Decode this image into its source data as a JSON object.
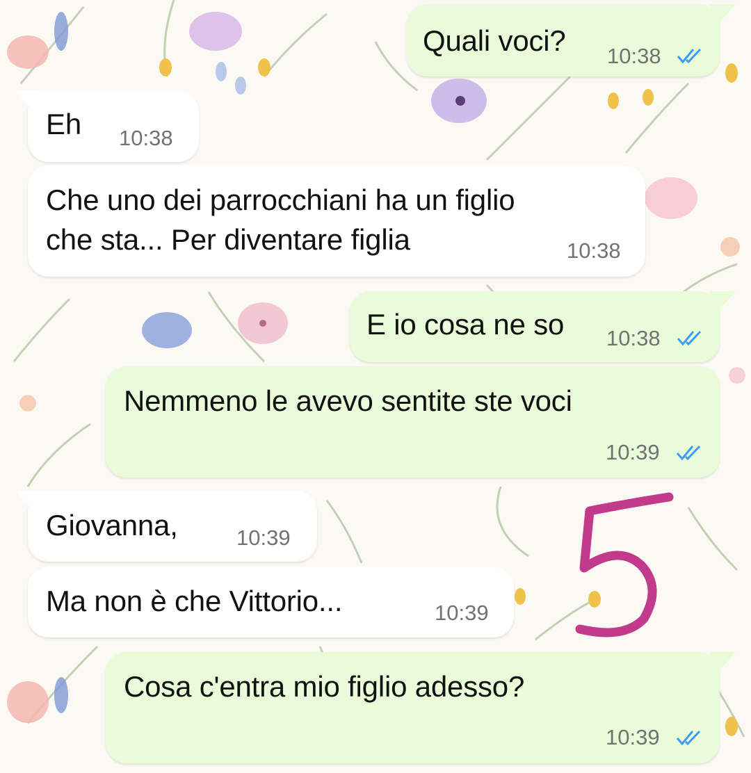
{
  "colors": {
    "incoming_bubble": "#ffffff",
    "outgoing_bubble": "#e9fbd9",
    "read_ticks": "#3a9df0",
    "annotation": "#c23a8b"
  },
  "messages": [
    {
      "direction": "outgoing",
      "text": "Quali voci?",
      "time": "10:38",
      "status": "read-ticks-icon"
    },
    {
      "direction": "incoming",
      "text": "Eh",
      "time": "10:38"
    },
    {
      "direction": "incoming",
      "line1": "Che uno dei parrocchiani ha un figlio",
      "line2": "che sta... Per diventare figlia",
      "time": "10:38"
    },
    {
      "direction": "outgoing",
      "text": "E io cosa ne so",
      "time": "10:38",
      "status": "read-ticks-icon"
    },
    {
      "direction": "outgoing",
      "text": "Nemmeno le avevo sentite ste voci",
      "time": "10:39",
      "status": "read-ticks-icon"
    },
    {
      "direction": "incoming",
      "text": "Giovanna,",
      "time": "10:39"
    },
    {
      "direction": "incoming",
      "text": "Ma non è che Vittorio...",
      "time": "10:39"
    },
    {
      "direction": "outgoing",
      "text": "Cosa c'entra mio figlio adesso?",
      "time": "10:39",
      "status": "read-ticks-icon"
    }
  ],
  "annotation": {
    "text": "5"
  }
}
